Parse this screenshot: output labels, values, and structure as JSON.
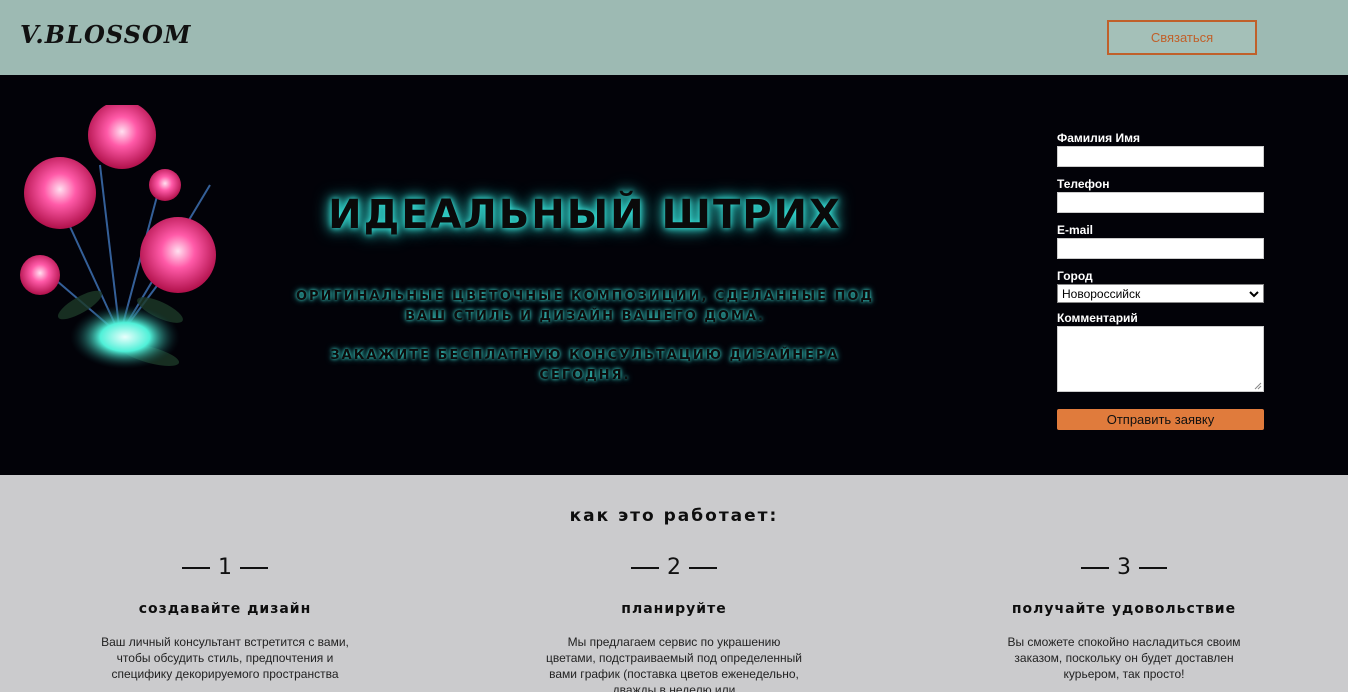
{
  "header": {
    "logo": "V.BLOSSOM",
    "contact_button": "Связаться"
  },
  "hero": {
    "title": "ИДЕАЛЬНЫЙ ШТРИХ",
    "subtitle_1": "оригинальные цветочные композиции, сделанные под ваш стиль и дизайн вашего дома.",
    "subtitle_2": "закажите бесплатную консультацию дизайнера сегодня."
  },
  "form": {
    "name_label": "Фамилия Имя",
    "phone_label": "Телефон",
    "email_label": "E-mail",
    "city_label": "Город",
    "city_value": "Новороссийск",
    "comment_label": "Комментарий",
    "submit_label": "Отправить заявку"
  },
  "how": {
    "title": "как это работает:",
    "steps": [
      {
        "number": "1",
        "title": "создавайте дизайн",
        "text": "Ваш личный консультант встретится с вами, чтобы обсудить стиль, предпочтения и специфику декорируемого пространства"
      },
      {
        "number": "2",
        "title": "планируйте",
        "text": "Мы предлагаем сервис по украшению цветами, подстраиваемый под определенный вами график (поставка цветов еженедельно, дважды в неделю или"
      },
      {
        "number": "3",
        "title": "получайте удовольствие",
        "text": "Вы сможете спокойно насладиться своим заказом, поскольку он будет доставлен курьером, так просто!"
      }
    ]
  },
  "colors": {
    "header_bg": "#9dbab3",
    "accent": "#e07b3c",
    "glow": "#39e0d8",
    "hero_bg": "#020208",
    "section_bg": "#cbcbcd"
  }
}
